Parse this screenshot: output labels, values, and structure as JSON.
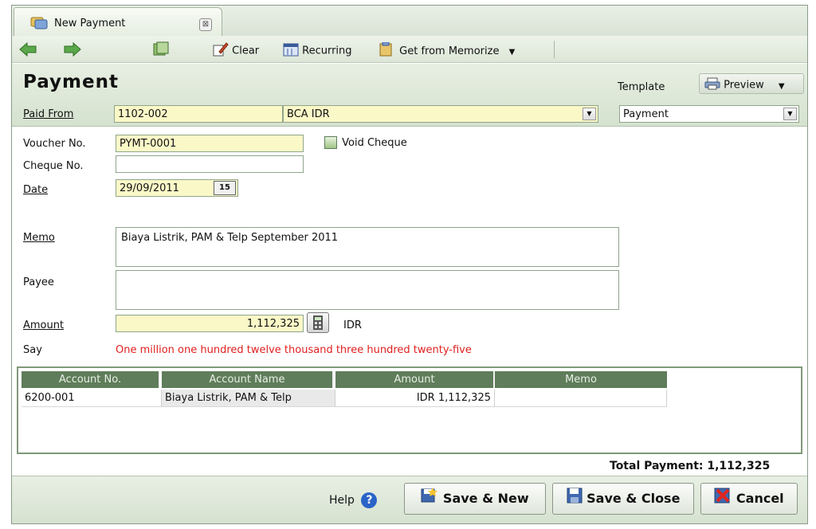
{
  "tab": {
    "title": "New Payment",
    "close_glyph": "⊠"
  },
  "toolbar": {
    "clear_label": "Clear",
    "recurring_label": "Recurring",
    "memorize_label": "Get from Memorize",
    "dropdown_glyph": "▼"
  },
  "header": {
    "title": "Payment",
    "template_label": "Template",
    "preview_label": "Preview",
    "paid_from_label": "Paid From",
    "paid_from_account": "1102-002",
    "paid_from_name": "BCA IDR",
    "template_value": "Payment"
  },
  "form": {
    "voucher_label": "Voucher No.",
    "voucher_value": "PYMT-0001",
    "void_cheque_label": "Void Cheque",
    "cheque_label": "Cheque No.",
    "cheque_value": "",
    "date_label": "Date",
    "date_value": "29/09/2011",
    "calendar_glyph": "15",
    "memo_label": "Memo",
    "memo_value": "Biaya Listrik, PAM & Telp September 2011",
    "payee_label": "Payee",
    "payee_value": "",
    "amount_label": "Amount",
    "amount_value": "1,112,325",
    "currency": "IDR",
    "say_label": "Say",
    "say_value": "One million one hundred twelve thousand three hundred twenty-five"
  },
  "grid": {
    "columns": [
      "Account No.",
      "Account Name",
      "Amount",
      "Memo"
    ],
    "rows": [
      {
        "account_no": "6200-001",
        "account_name": "Biaya Listrik, PAM & Telp",
        "amount": "IDR 1,112,325",
        "memo": ""
      }
    ]
  },
  "total_label": "Total Payment: 1,112,325",
  "footer": {
    "help_label": "Help",
    "save_new_label": "Save & New",
    "save_close_label": "Save & Close",
    "cancel_label": "Cancel"
  },
  "colors": {
    "field_yellow": "#fbf8c8",
    "grid_header": "#5f7d5a",
    "say_red": "#e02020",
    "accent_green": "#d9e3d5"
  }
}
